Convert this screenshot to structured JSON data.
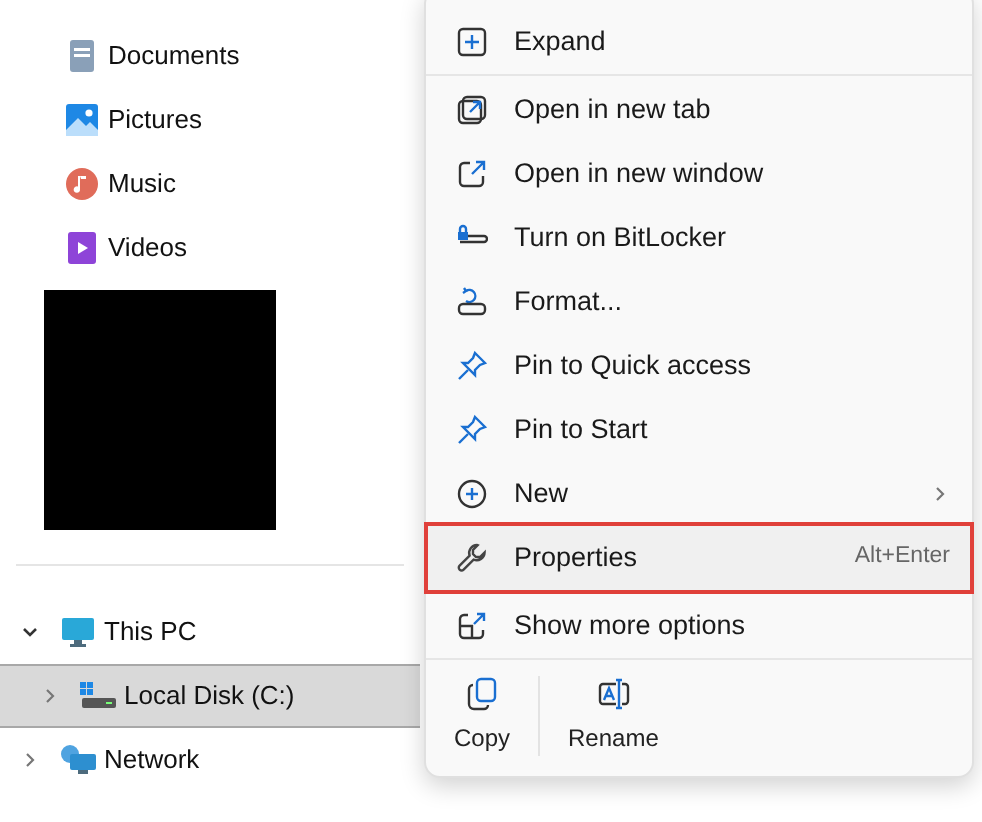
{
  "sidebar": {
    "items": [
      {
        "label": "Documents",
        "kind": "documents"
      },
      {
        "label": "Pictures",
        "kind": "pictures"
      },
      {
        "label": "Music",
        "kind": "music"
      },
      {
        "label": "Videos",
        "kind": "videos"
      }
    ],
    "redacted": true,
    "tree": [
      {
        "label": "This PC",
        "kind": "pc",
        "expanded": true,
        "selected": false,
        "children": [
          {
            "label": "Local Disk (C:)",
            "kind": "disk",
            "expanded": false,
            "selected": true
          }
        ]
      },
      {
        "label": "Network",
        "kind": "network",
        "expanded": false,
        "selected": false
      }
    ]
  },
  "context_menu": {
    "sections": [
      [
        {
          "label": "Expand",
          "kind": "expand",
          "highlighted": false
        }
      ],
      [
        {
          "label": "Open in new tab",
          "kind": "newtab",
          "highlighted": false
        },
        {
          "label": "Open in new window",
          "kind": "newwindow",
          "highlighted": false
        },
        {
          "label": "Turn on BitLocker",
          "kind": "bitlocker",
          "highlighted": false
        },
        {
          "label": "Format...",
          "kind": "format",
          "highlighted": false
        },
        {
          "label": "Pin to Quick access",
          "kind": "pin",
          "highlighted": false
        },
        {
          "label": "Pin to Start",
          "kind": "pin",
          "highlighted": false
        },
        {
          "label": "New",
          "kind": "new",
          "submenu": true,
          "highlighted": false
        },
        {
          "label": "Properties",
          "kind": "properties",
          "shortcut": "Alt+Enter",
          "highlighted": true
        }
      ],
      [
        {
          "label": "Show more options",
          "kind": "more",
          "highlighted": false
        }
      ]
    ],
    "actions": [
      {
        "label": "Copy",
        "kind": "copy"
      },
      {
        "label": "Rename",
        "kind": "rename"
      }
    ]
  }
}
